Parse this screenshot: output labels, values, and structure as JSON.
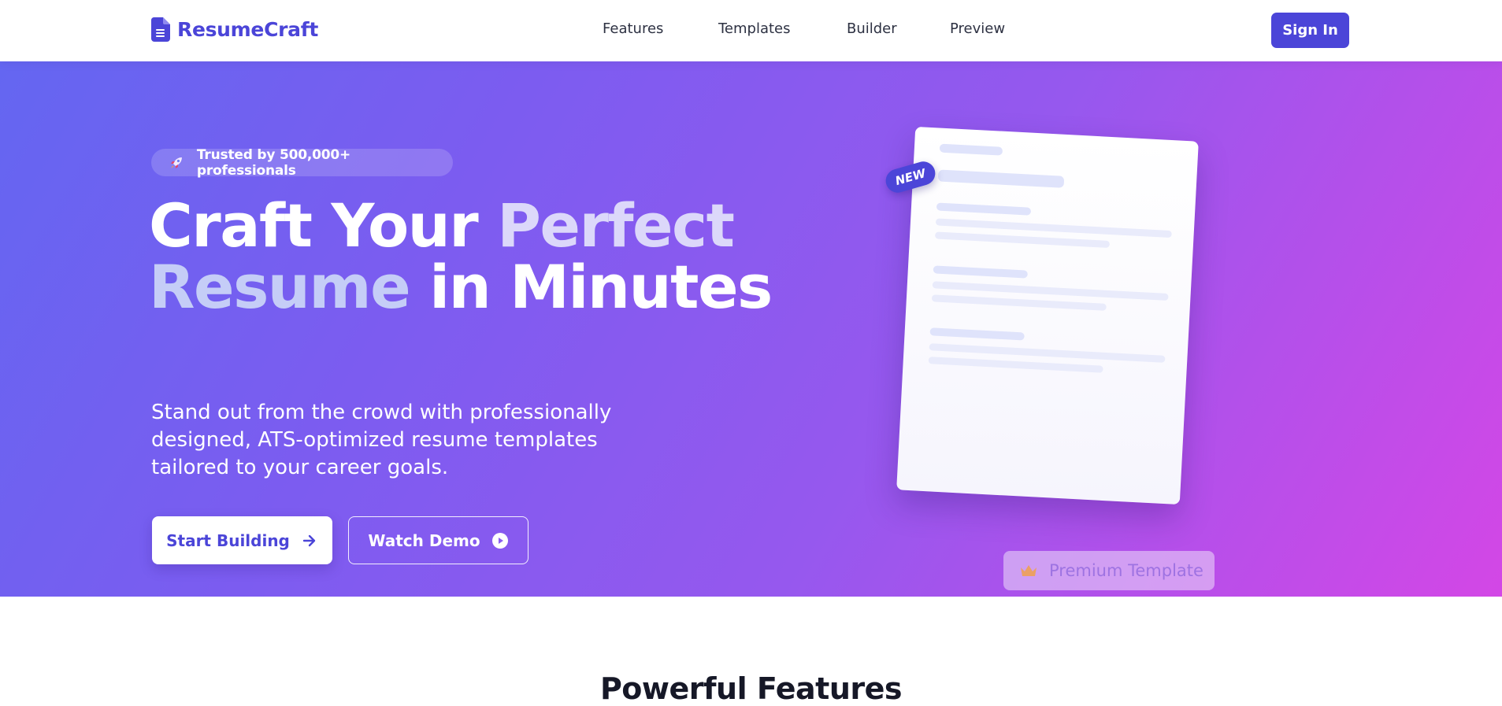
{
  "nav": {
    "brand": "ResumeCraft",
    "links": [
      {
        "label": "Features"
      },
      {
        "label": "Templates"
      },
      {
        "label": "Builder"
      },
      {
        "label": "Preview"
      }
    ],
    "sign_in": "Sign In"
  },
  "hero": {
    "badge_icon": "rocket-icon",
    "badge_text": "Trusted by 500,000+ professionals",
    "headline": {
      "line1_a": "Craft Your ",
      "line1_b": "Perfect",
      "line2_a": "Resume",
      "line2_b": " in Minutes"
    },
    "subtext": "Stand out from the crowd with professionally designed, ATS-optimized resume templates tailored to your career goals.",
    "primary_button": "Start Building",
    "secondary_button": "Watch Demo",
    "new_tag": "NEW",
    "premium_label": "Premium Template"
  },
  "features": {
    "title": "Powerful Features"
  },
  "colors": {
    "brand": "#4b45d8",
    "hero_gradient_start": "#6466f1",
    "hero_gradient_end": "#d347e6",
    "accent_text": "#dcd8fa"
  }
}
